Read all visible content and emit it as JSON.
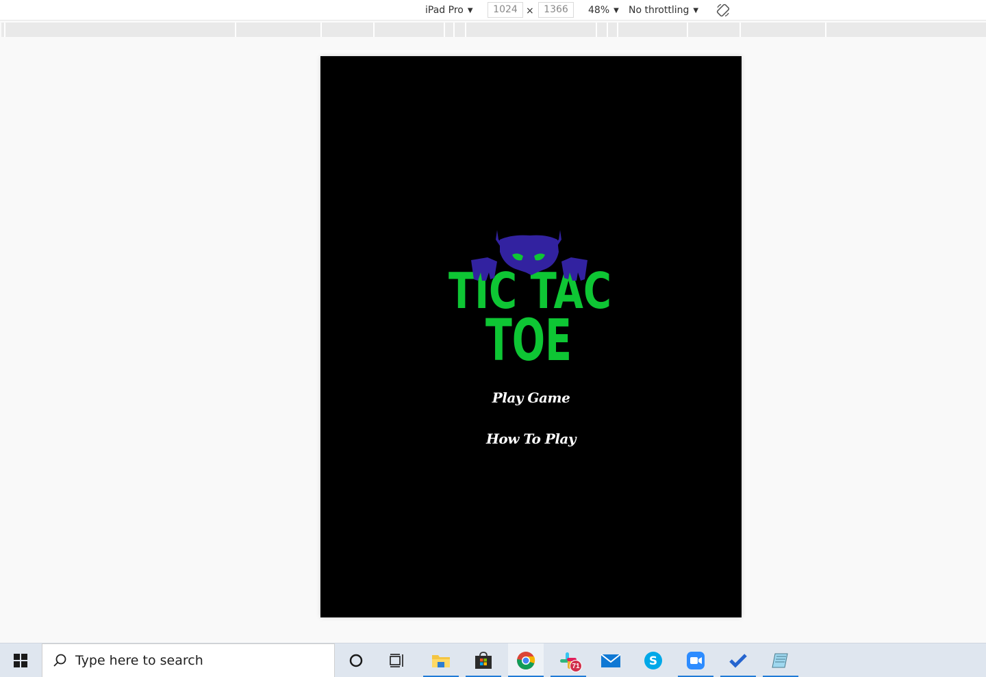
{
  "device_toolbar": {
    "device": "iPad Pro",
    "width": "1024",
    "height": "1366",
    "times": "×",
    "zoom": "48%",
    "throttling": "No throttling"
  },
  "app": {
    "logo_line1": "TIC TAC",
    "logo_line2": "TOE",
    "menu": [
      "Play Game",
      "How To Play"
    ],
    "colors": {
      "logo_green": "#0ec634",
      "monster_purple": "#3222a0",
      "background": "#000000",
      "menu_text": "#ffffff"
    }
  },
  "taskbar": {
    "search_placeholder": "Type here to search",
    "icons": [
      "windows-start-icon",
      "cortana-icon",
      "task-view-icon",
      "file-explorer-icon",
      "microsoft-store-icon",
      "chrome-icon",
      "slack-icon",
      "mail-icon",
      "skype-icon",
      "zoom-icon",
      "todo-icon",
      "notepad-icon"
    ],
    "slack_badge": "71"
  }
}
